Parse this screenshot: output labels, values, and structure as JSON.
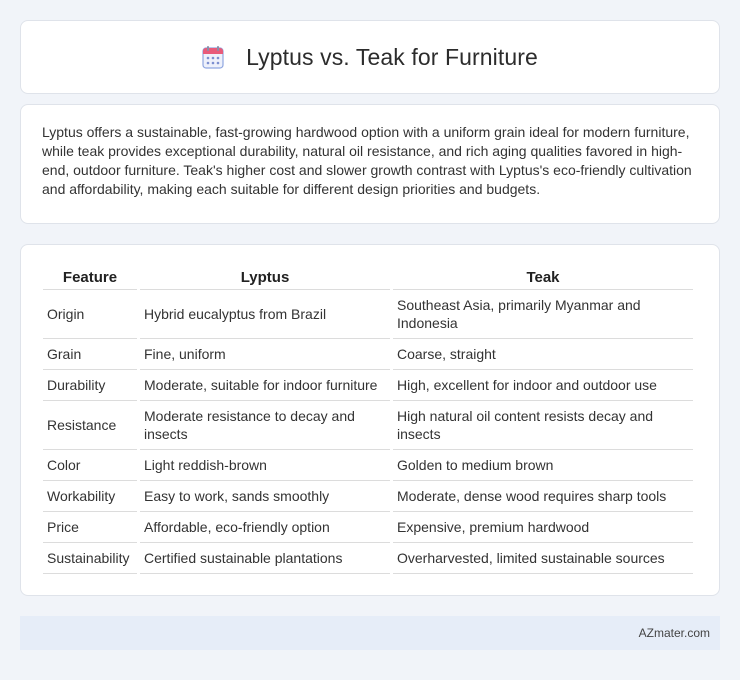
{
  "header": {
    "icon": "calendar-icon",
    "title": "Lyptus vs. Teak for Furniture"
  },
  "summary": {
    "text": "Lyptus offers a sustainable, fast-growing hardwood option with a uniform grain ideal for modern furniture, while teak provides exceptional durability, natural oil resistance, and rich aging qualities favored in high-end, outdoor furniture. Teak's higher cost and slower growth contrast with Lyptus's eco-friendly cultivation and affordability, making each suitable for different design priorities and budgets."
  },
  "table": {
    "headers": [
      "Feature",
      "Lyptus",
      "Teak"
    ],
    "rows": [
      [
        "Origin",
        "Hybrid eucalyptus from Brazil",
        "Southeast Asia, primarily Myanmar and Indonesia"
      ],
      [
        "Grain",
        "Fine, uniform",
        "Coarse, straight"
      ],
      [
        "Durability",
        "Moderate, suitable for indoor furniture",
        "High, excellent for indoor and outdoor use"
      ],
      [
        "Resistance",
        "Moderate resistance to decay and insects",
        "High natural oil content resists decay and insects"
      ],
      [
        "Color",
        "Light reddish-brown",
        "Golden to medium brown"
      ],
      [
        "Workability",
        "Easy to work, sands smoothly",
        "Moderate, dense wood requires sharp tools"
      ],
      [
        "Price",
        "Affordable, eco-friendly option",
        "Expensive, premium hardwood"
      ],
      [
        "Sustainability",
        "Certified sustainable plantations",
        "Overharvested, limited sustainable sources"
      ]
    ]
  },
  "footer": {
    "brand": "AZmater.com"
  },
  "colors": {
    "page_background": "#f1f4f9",
    "footer_background": "#e6edf8",
    "icon_accent": "#6d8fd9"
  }
}
